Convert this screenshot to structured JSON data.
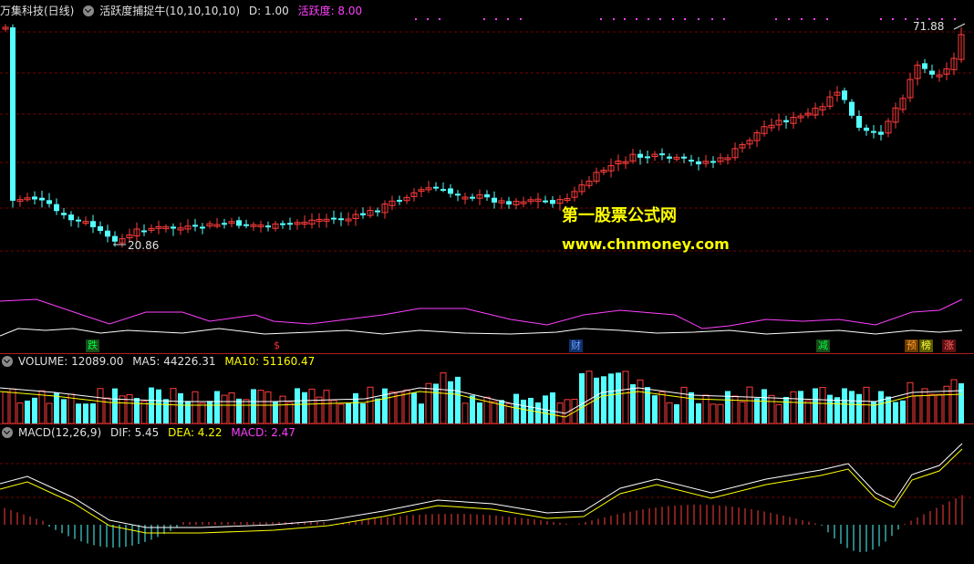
{
  "header": {
    "stock_title": "万集科技(日线)",
    "indicator_name": "活跃度捕捉牛(10,10,10,10)",
    "d_value": "D: 1.00",
    "activity_label": "活跃度: 8.00"
  },
  "price": {
    "high_label": "71.88",
    "low_label": "20.86"
  },
  "watermark": {
    "line1": "第一股票公式网",
    "line2": "www.chnmoney.com"
  },
  "signals": [
    {
      "text": "跌",
      "color": "#00c000"
    },
    {
      "text": "$",
      "color": "#ff3030"
    },
    {
      "text": "财",
      "color": "#4080ff"
    },
    {
      "text": "减",
      "color": "#00c000"
    },
    {
      "text": "预",
      "color": "#ff8000"
    },
    {
      "text": "榜",
      "color": "#ffff00"
    },
    {
      "text": "涨",
      "color": "#ff3030"
    }
  ],
  "volume": {
    "label": "VOLUME: 12089.00",
    "ma5": "MA5: 44226.31",
    "ma10": "MA10: 51160.47"
  },
  "macd": {
    "label": "MACD(12,26,9)",
    "dif": "DIF: 5.45",
    "dea": "DEA: 4.22",
    "macd": "MACD: 2.47"
  },
  "colors": {
    "up": "#ff3c3c",
    "down": "#54ffff",
    "grid": "#7a0000",
    "white": "#ffffff",
    "yellow": "#ffff00",
    "magenta": "#ff40ff"
  }
}
